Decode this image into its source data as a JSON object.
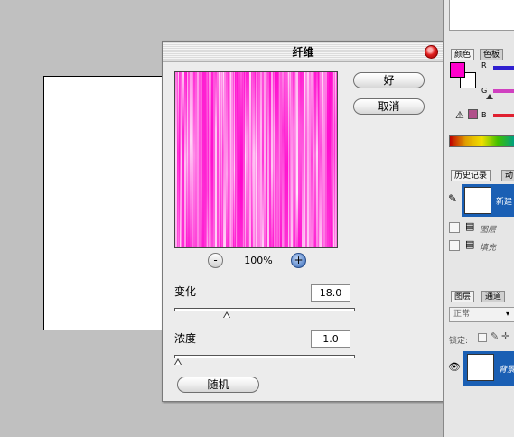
{
  "dialog": {
    "title": "纤维",
    "ok_label": "好",
    "cancel_label": "取消",
    "random_label": "随机",
    "zoom": {
      "out_label": "-",
      "in_label": "+",
      "level": "100%"
    },
    "variance": {
      "label": "变化",
      "value": "18.0",
      "slider_fraction": 0.28
    },
    "strength": {
      "label": "浓度",
      "value": "1.0",
      "slider_fraction": 0.0
    },
    "preview_color": "#ff00cc"
  },
  "color_panel": {
    "tabs": [
      "颜色",
      "色板"
    ],
    "channels": [
      "R",
      "G",
      "B"
    ],
    "foreground": "#ff00cc",
    "background": "#ffffff"
  },
  "history_panel": {
    "tabs": [
      "历史记录",
      "动"
    ],
    "items": [
      "新建",
      "图层",
      "填充"
    ]
  },
  "layers_panel": {
    "tabs": [
      "图层",
      "通道"
    ],
    "blend_mode": "正常",
    "lock_label": "锁定:",
    "layer_name": "背景"
  }
}
